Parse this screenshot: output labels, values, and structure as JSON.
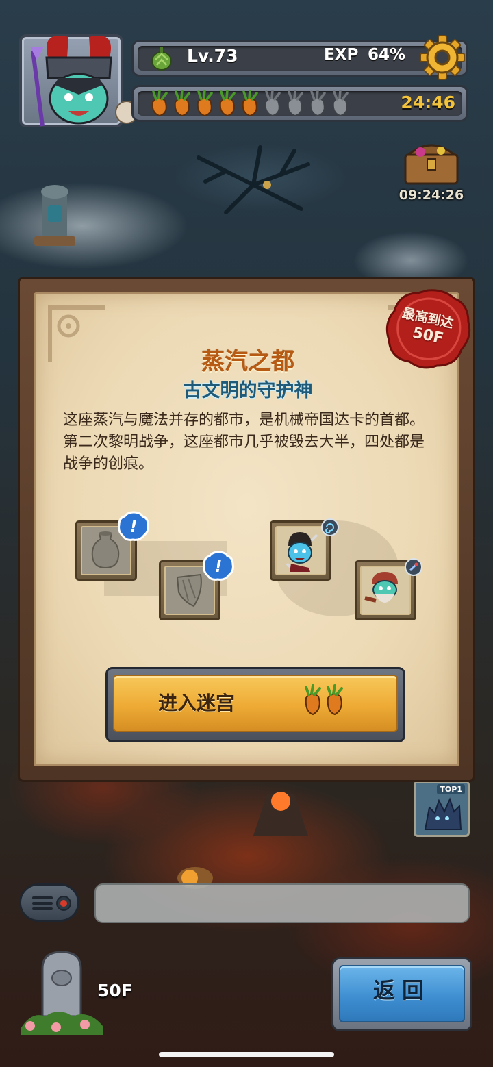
{
  "hud": {
    "level": "Lv.73",
    "exp_label": "EXP",
    "exp_percent": "64%",
    "exp_fraction": 0.64,
    "energy_full": 5,
    "energy_max": 9,
    "energy_timer": "24:46",
    "settings_icon": "gear-icon",
    "level_icon": "artichoke-icon",
    "energy_icon": "carrot-icon"
  },
  "chest": {
    "timer": "09:24:26",
    "icon": "treasure-chest-icon"
  },
  "panel": {
    "title": "蒸汽之都",
    "subtitle": "古文明的守护神",
    "description": "这座蒸汽与魔法并存的都市，是机械帝国达卡的首都。第二次黎明战争，这座都市几乎被毁去大半，四处都是战争的创痕。",
    "seal_line1": "最高到达",
    "seal_line2": "50F",
    "items": [
      {
        "icon": "vase-relic-icon",
        "badge": "!"
      },
      {
        "icon": "shield-fragment-icon",
        "badge": "!"
      }
    ],
    "heroes": [
      {
        "icon": "hero-blue-sword-icon",
        "badge_icon": "swirl-icon"
      },
      {
        "icon": "hero-bearded-dwarf-icon",
        "badge_icon": "dagger-icon"
      }
    ],
    "enter_button_label": "进入迷宫",
    "enter_cost_icon": "carrot-icon"
  },
  "ranking": {
    "label": "TOP1"
  },
  "chat": {
    "placeholder": ""
  },
  "bottom": {
    "floor": "50F",
    "back_label": "返回"
  },
  "colors": {
    "title": "#b75a14",
    "subtitle": "#1f5b79",
    "timer": "#f2c33b",
    "enter_button": "#eeab35",
    "back_button": "#3c8ccf",
    "seal": "#b3201b"
  }
}
